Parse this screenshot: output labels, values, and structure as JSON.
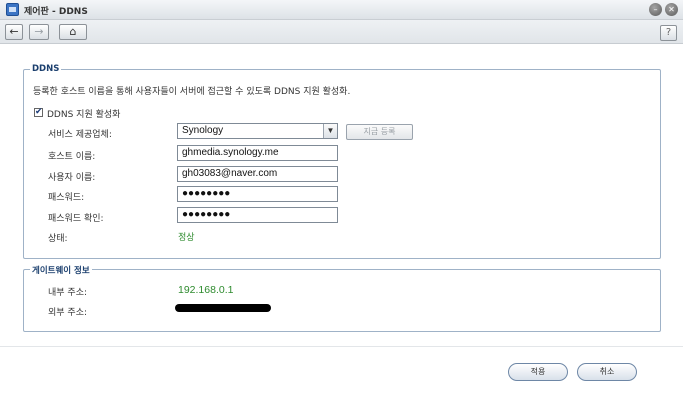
{
  "window": {
    "title": "제어판 - DDNS",
    "app_icon": "control-panel-icon",
    "minimize_icon": "minimize-icon",
    "close_icon": "close-icon"
  },
  "toolbar": {
    "back_icon": "←",
    "forward_icon": "→",
    "home_icon": "⌂",
    "help_label": "?"
  },
  "ddns": {
    "legend": "DDNS",
    "description": "등록한 호스트 이름을 통해 사용자들이 서버에 접근할 수 있도록 DDNS 지원 활성화.",
    "enable_label": "DDNS 지원 활성화",
    "enabled": true,
    "checkmark": "✔",
    "provider_label": "서비스 제공업체:",
    "provider_value": "Synology",
    "provider_arrow": "▼",
    "register_button": "지금 등록",
    "hostname_label": "호스트 이름:",
    "hostname_value": "ghmedia.synology.me",
    "username_label": "사용자 이름:",
    "username_value": "gh03083@naver.com",
    "password_label": "패스워드:",
    "password_value": "●●●●●●●●",
    "confirm_label": "패스워드 확인:",
    "confirm_value": "●●●●●●●●",
    "status_label": "상태:",
    "status_value": "정상"
  },
  "gateway": {
    "legend": "게이트웨이 정보",
    "internal_label": "내부 주소:",
    "internal_value": "192.168.0.1",
    "external_label": "외부 주소:"
  },
  "footer": {
    "apply_label": "적용",
    "cancel_label": "취소"
  },
  "colors": {
    "accent": "#1b3f6e",
    "status_ok": "#2e8b2e",
    "border": "#9fb2c7"
  }
}
